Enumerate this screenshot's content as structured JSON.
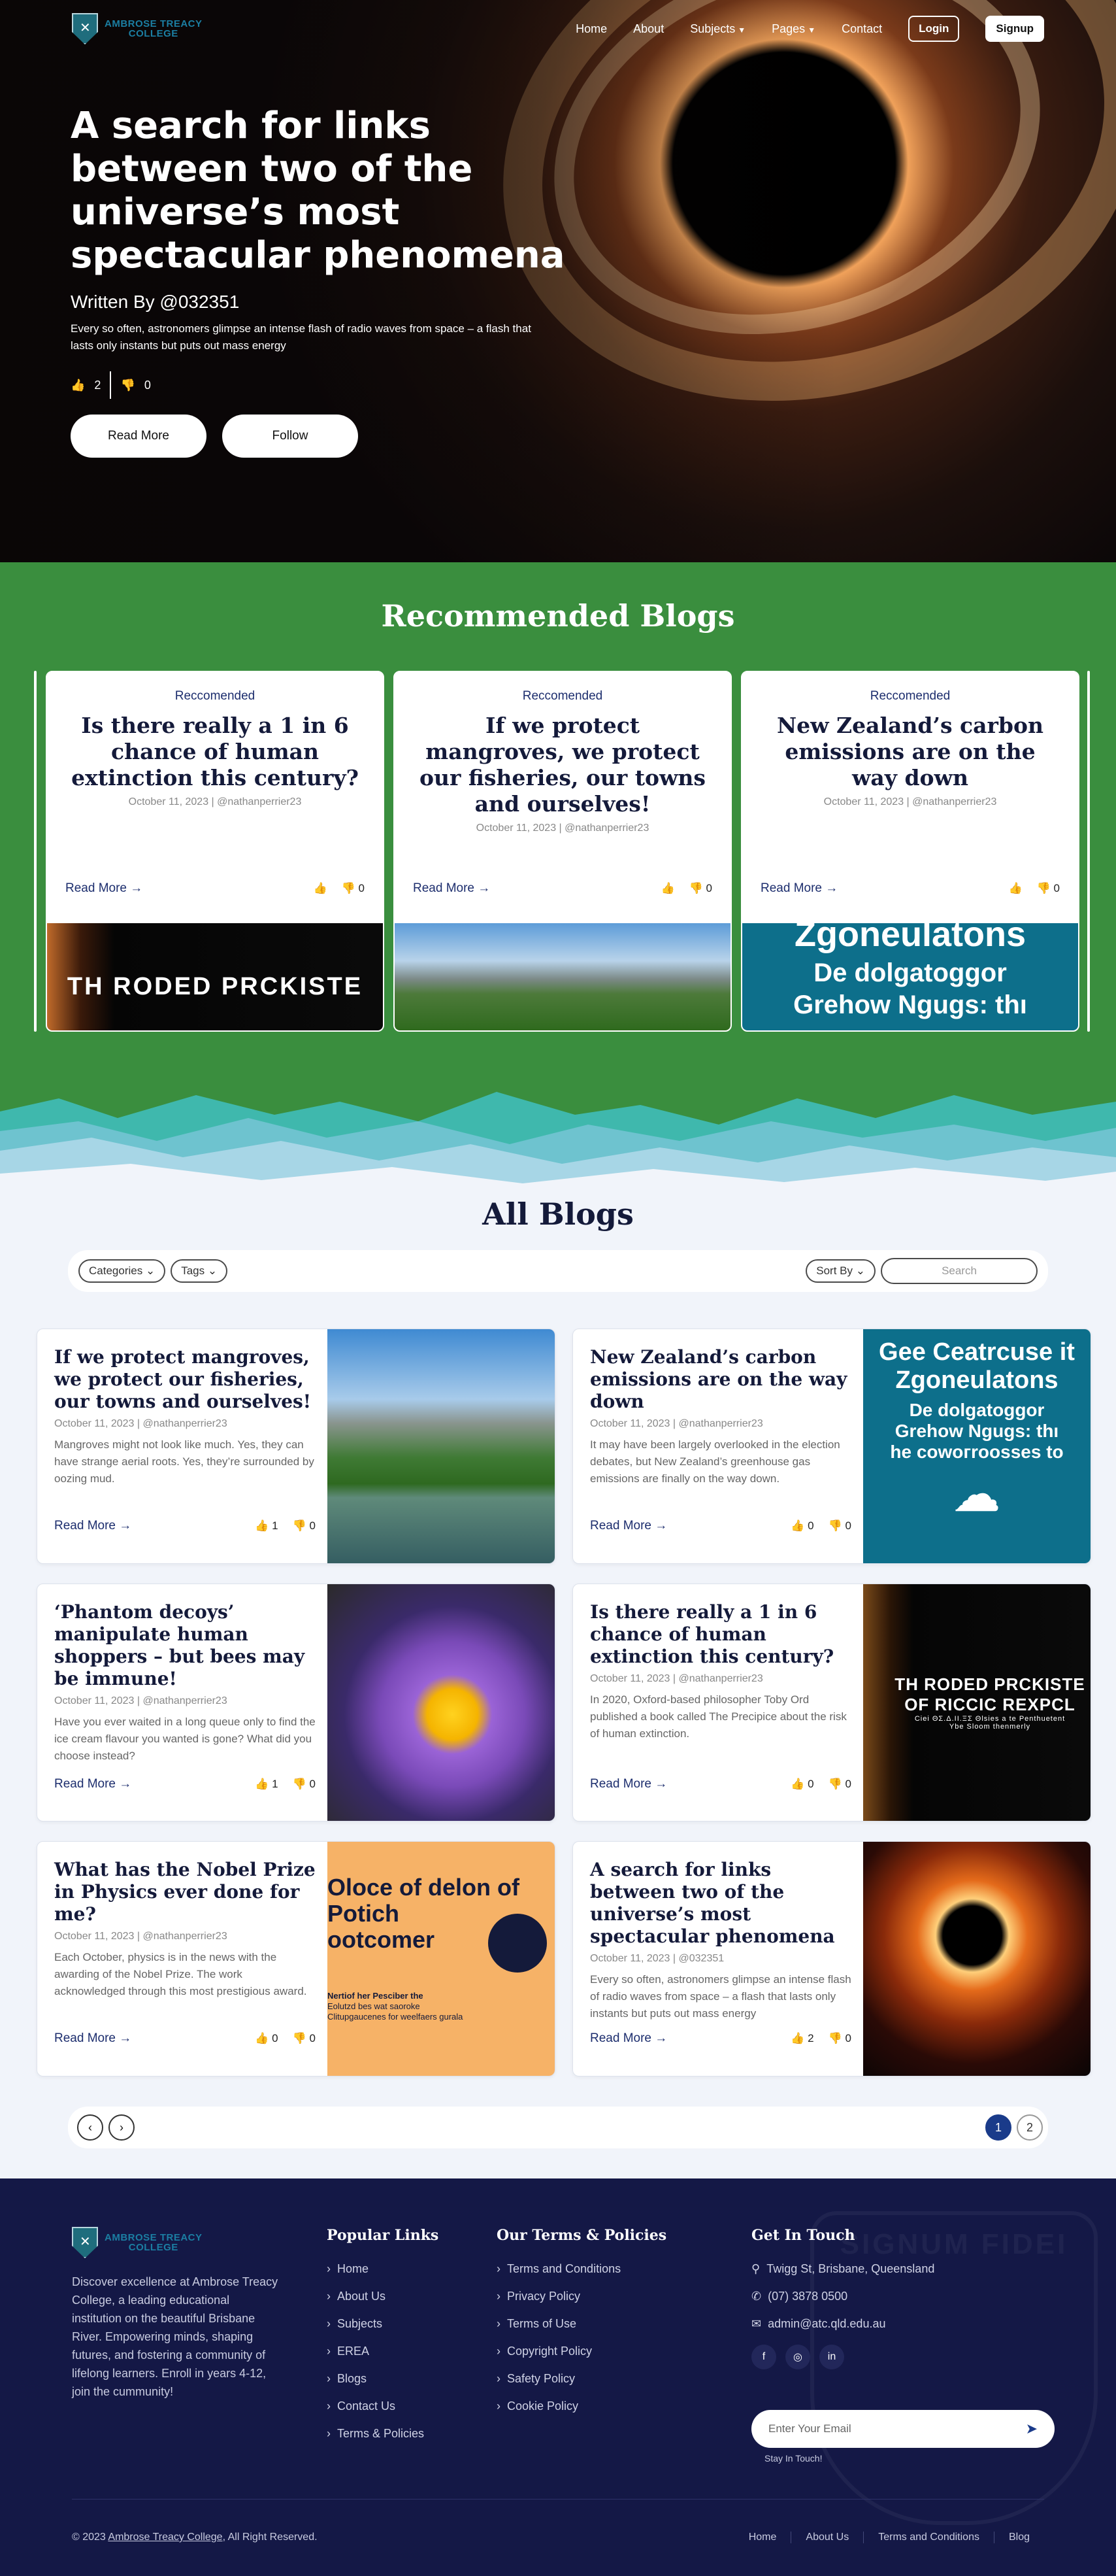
{
  "nav": {
    "logo_line1": "AMBROSE TREACY",
    "logo_line2": "COLLEGE",
    "items": [
      "Home",
      "About",
      "Subjects",
      "Pages",
      "Contact"
    ],
    "login": "Login",
    "signup": "Signup"
  },
  "hero": {
    "title": "A search for links between two of the universe’s most spectacular phenomena",
    "author": "Written By @032351",
    "description": "Every so often, astronomers glimpse an intense flash of radio waves from space – a flash that lasts only instants but puts out mass energy",
    "likes": "2",
    "dislikes": "0",
    "read_more": "Read More",
    "follow": "Follow"
  },
  "recommended": {
    "heading": "Recommended Blogs",
    "cards": [
      {
        "tag": "Reccomended",
        "title": "Is there really a 1 in 6 chance of human extinction this century?",
        "date": "October 11, 2023",
        "author": "@nathanperrier23",
        "read_more": "Read More →",
        "likes": "",
        "dislikes": "0",
        "img_text": "TH RODED PRCKISTE"
      },
      {
        "tag": "Reccomended",
        "title": "If we protect mangroves, we protect our fisheries, our towns and ourselves!",
        "date": "October 11, 2023",
        "author": "@nathanperrier23",
        "read_more": "Read More →",
        "likes": "",
        "dislikes": "0"
      },
      {
        "tag": "Reccomended",
        "title": "New Zealand’s carbon emissions are on the way down",
        "date": "October 11, 2023",
        "author": "@nathanperrier23",
        "read_more": "Read More →",
        "likes": "",
        "dislikes": "0",
        "img_line1": "Zgoneulatons",
        "img_line2": "De dolgatoggor",
        "img_line3": "Grehow Ngugs: thı"
      }
    ]
  },
  "all_blogs": {
    "heading": "All Blogs",
    "filters": {
      "categories": "Categories",
      "tags": "Tags",
      "sort": "Sort By",
      "search_placeholder": "Search"
    },
    "cards": [
      {
        "title": "If we protect mangroves, we protect our fisheries, our towns and ourselves!",
        "date": "October 11, 2023",
        "author": "@nathanperrier23",
        "excerpt": "Mangroves might not look like much. Yes, they can have strange aerial roots. Yes, they’re surrounded by oozing mud.",
        "read_more": "Read More →",
        "likes": "1",
        "dislikes": "0"
      },
      {
        "title": "New Zealand’s carbon emissions are on the way down",
        "date": "October 11, 2023",
        "author": "@nathanperrier23",
        "excerpt": "It may have been largely overlooked in the election debates, but New Zealand’s greenhouse gas emissions are finally on the way down.",
        "read_more": "Read More →",
        "likes": "0",
        "dislikes": "0",
        "img_line1": "Gee Ceatrcuse it",
        "img_line2": "Zgoneulatons",
        "img_line3": "De dolgatoggor",
        "img_line4": "Grehow Ngugs: thı",
        "img_line5": "he cowoгroosses to"
      },
      {
        "title": "‘Phantom decoys’ manipulate human shoppers – but bees may be immune!",
        "date": "October 11, 2023",
        "author": "@nathanperrier23",
        "excerpt": "Have you ever waited in a long queue only to find the ice cream flavour you wanted is gone? What did you choose instead?",
        "read_more": "Read More →",
        "likes": "1",
        "dislikes": "0"
      },
      {
        "title": "Is there really a 1 in 6 chance of human extinction this century?",
        "date": "October 11, 2023",
        "author": "@nathanperrier23",
        "excerpt": "In 2020, Oxford-based philosopher Toby Ord published a book called The Precipice about the risk of human extinction.",
        "read_more": "Read More →",
        "likes": "0",
        "dislikes": "0",
        "img_line1": "TH RODED PRCKISTE",
        "img_line2": "OF RICCIC REXPCL",
        "img_line3": "Ciei ΘΣ.Δ.ΙΙ.ΞΣ Θlsies a te Penthuetent",
        "img_line4": "Ybe Sloom thenmerly"
      },
      {
        "title": "What has the Nobel Prize in Physics ever done for me?",
        "date": "October 11, 2023",
        "author": "@nathanperrier23",
        "excerpt": "Each October, physics is in the news with the awarding of the Nobel Prize. The work acknowledged through this most prestigious award.",
        "read_more": "Read More →",
        "likes": "0",
        "dislikes": "0",
        "img_line1": "Oloce of delon of",
        "img_line2": "Potich",
        "img_line3": "ootcomer",
        "img_line4": "Nertiof her Pesciber the",
        "img_line5": "Eolutzd bes wat saoroke",
        "img_line6": "Clitupgaucenes for weelfaers gurala"
      },
      {
        "title": "A search for links between two of the universe’s most spectacular phenomena",
        "date": "October 11, 2023",
        "author": "@032351",
        "excerpt": "Every so often, astronomers glimpse an intense flash of radio waves from space – a flash that lasts only instants but puts out mass energy",
        "read_more": "Read More →",
        "likes": "2",
        "dislikes": "0"
      }
    ],
    "pages": [
      "1",
      "2"
    ]
  },
  "footer": {
    "logo_line1": "AMBROSE TREACY",
    "logo_line2": "COLLEGE",
    "about": "Discover excellence at Ambrose Treacy College, a leading educational institution on the beautiful Brisbane River. Empowering minds, shaping futures, and fostering a community of lifelong learners. Enroll in years 4-12, join the cummunity!",
    "popular_heading": "Popular Links",
    "popular_links": [
      "Home",
      "About Us",
      "Subjects",
      "EREA",
      "Blogs",
      "Contact Us",
      "Terms & Policies"
    ],
    "terms_heading": "Our Terms & Policies",
    "terms_links": [
      "Terms and Conditions",
      "Privacy Policy",
      "Terms of Use",
      "Copyright Policy",
      "Safety Policy",
      "Cookie Policy"
    ],
    "contact_heading": "Get In Touch",
    "address": "Twigg St, Brisbane, Queensland",
    "phone": "(07) 3878 0500",
    "email": "admin@atc.qld.edu.au",
    "email_placeholder": "Enter Your Email",
    "stay_in_touch": "Stay In Touch!",
    "watermark": "SIGNUM FIDEI",
    "copyright_prefix": "© 2023 ",
    "copyright_link": "Ambrose Treacy College",
    "copyright_suffix": ", All Right Reserved.",
    "bottom_links": [
      "Home",
      "About Us",
      "Terms and Conditions",
      "Blog"
    ]
  }
}
